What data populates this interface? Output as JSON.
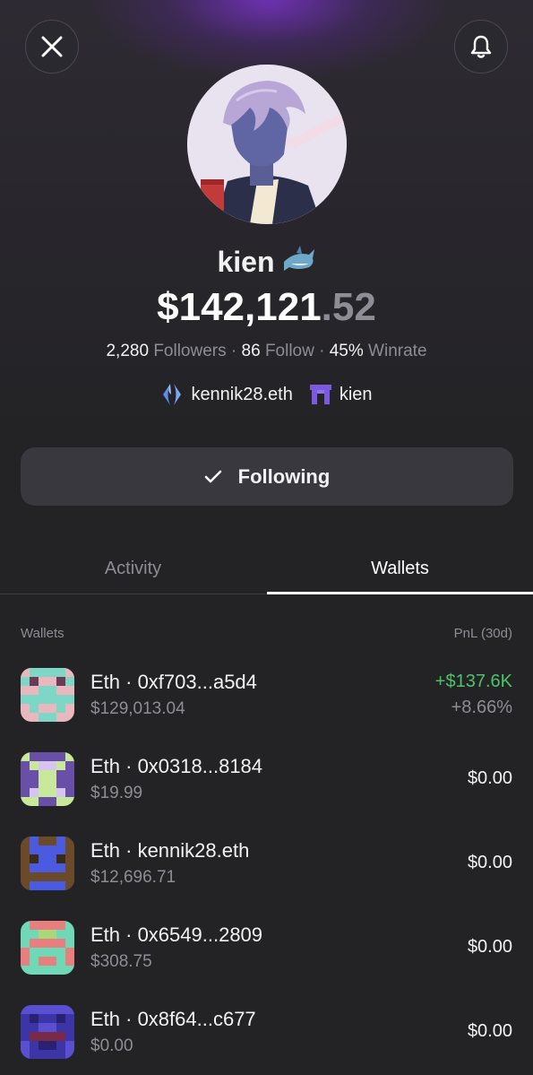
{
  "profile": {
    "name": "kien",
    "badge_icon": "shark-icon",
    "balance_main": "$142,121",
    "balance_cents": ".52",
    "followers_count": "2,280",
    "followers_label": "Followers",
    "follow_count": "86",
    "follow_label": "Follow",
    "winrate_value": "45%",
    "winrate_label": "Winrate",
    "separator": "·",
    "ens_name": "kennik28.eth",
    "handle": "kien"
  },
  "actions": {
    "follow_label": "Following"
  },
  "tabs": [
    {
      "label": "Activity",
      "active": false
    },
    {
      "label": "Wallets",
      "active": true
    }
  ],
  "wallets_table": {
    "header_left": "Wallets",
    "header_right": "PnL (30d)",
    "rows": [
      {
        "name": "Eth · 0xf703...a5d4",
        "balance": "$129,013.04",
        "pnl": "+$137.6K",
        "pnl_pct": "+8.66%"
      },
      {
        "name": "Eth · 0x0318...8184",
        "balance": "$19.99",
        "pnl": "$0.00"
      },
      {
        "name": "Eth · kennik28.eth",
        "balance": "$12,696.71",
        "pnl": "$0.00"
      },
      {
        "name": "Eth · 0x6549...2809",
        "balance": "$308.75",
        "pnl": "$0.00"
      },
      {
        "name": "Eth · 0x8f64...c677",
        "balance": "$0.00",
        "pnl": "$0.00"
      }
    ]
  },
  "colors": {
    "background": "#232326",
    "accent_purple": "#7832c8",
    "positive_green": "#4cc36b",
    "muted_text": "#8e8c95"
  }
}
